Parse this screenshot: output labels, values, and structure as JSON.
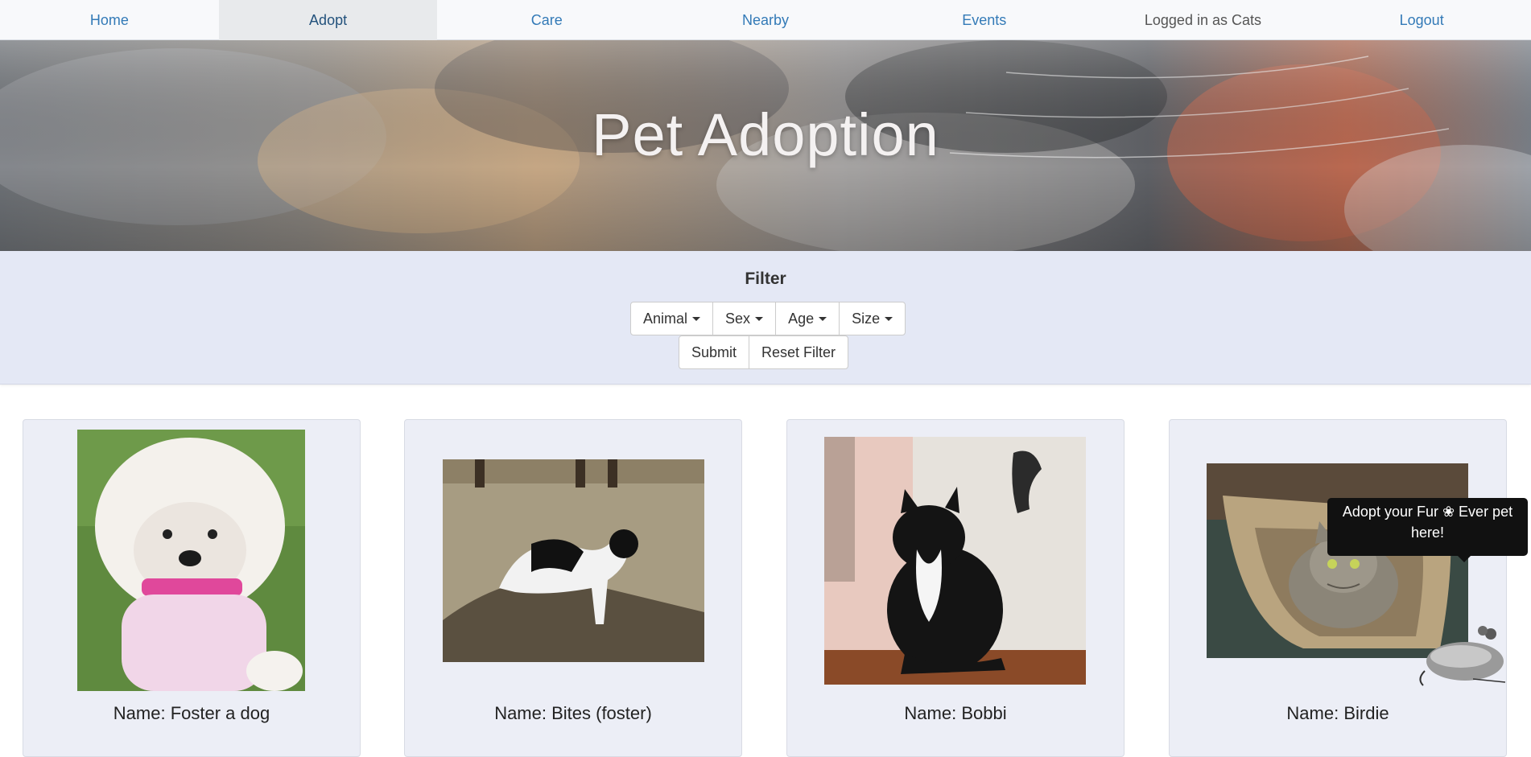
{
  "nav": {
    "items": [
      {
        "label": "Home"
      },
      {
        "label": "Adopt"
      },
      {
        "label": "Care"
      },
      {
        "label": "Nearby"
      },
      {
        "label": "Events"
      },
      {
        "label": "Logged in as Cats"
      },
      {
        "label": "Logout"
      }
    ],
    "active_index": 1
  },
  "hero": {
    "title": "Pet Adoption"
  },
  "filter": {
    "title": "Filter",
    "dropdowns": [
      {
        "label": "Animal"
      },
      {
        "label": "Sex"
      },
      {
        "label": "Age"
      },
      {
        "label": "Size"
      }
    ],
    "submit_label": "Submit",
    "reset_label": "Reset Filter"
  },
  "pets": [
    {
      "name": "Name: Foster a dog",
      "photo": "white-poodle-photo"
    },
    {
      "name": "Name: Bites (foster)",
      "photo": "black-white-cat-photo"
    },
    {
      "name": "Name: Bobbi",
      "photo": "tuxedo-cat-photo"
    },
    {
      "name": "Name: Birdie",
      "photo": "tabby-cat-photo"
    }
  ],
  "tooltip": {
    "line1": "Adopt your Fur ❀ Ever pet",
    "line2": "here!"
  },
  "colors": {
    "link": "#337ab7",
    "filter_bg": "#e4e8f5",
    "card_bg": "#eceef6",
    "tooltip_bg": "#111111"
  }
}
